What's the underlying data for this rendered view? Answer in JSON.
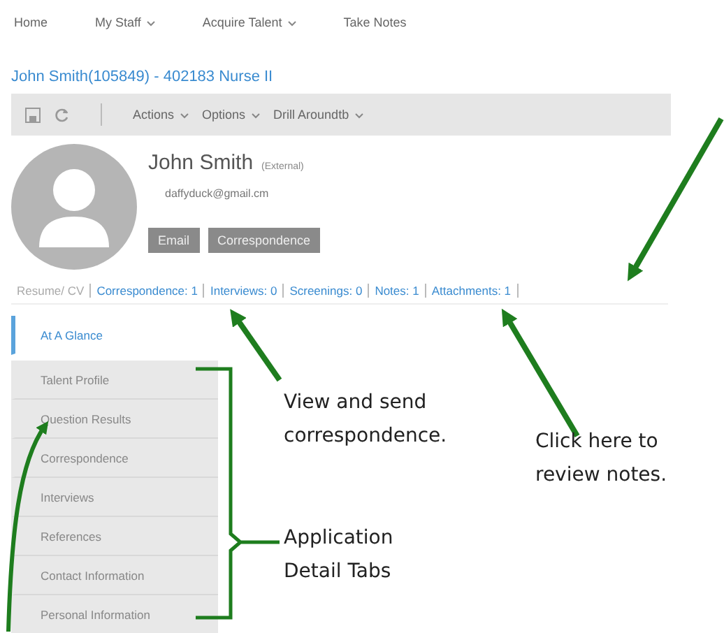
{
  "nav": [
    {
      "label": "Home",
      "dropdown": false
    },
    {
      "label": "My Staff",
      "dropdown": true
    },
    {
      "label": "Acquire Talent",
      "dropdown": true
    },
    {
      "label": "Take Notes",
      "dropdown": false
    }
  ],
  "page_title": "John Smith(105849) - 402183 Nurse II",
  "toolbar": {
    "menus": [
      "Actions",
      "Options",
      "Drill Aroundtb"
    ]
  },
  "profile": {
    "name": "John Smith",
    "badge": "(External)",
    "email": "daffyduck@gmail.cm",
    "buttons": [
      "Email",
      "Correspondence"
    ]
  },
  "links": [
    {
      "label": "Resume/ CV",
      "active": false
    },
    {
      "label": "Correspondence: 1",
      "active": true
    },
    {
      "label": "Interviews: 0",
      "active": true
    },
    {
      "label": "Screenings: 0",
      "active": true
    },
    {
      "label": "Notes: 1",
      "active": true
    },
    {
      "label": "Attachments: 1",
      "active": true
    }
  ],
  "side_tabs": [
    {
      "label": "At A Glance",
      "selected": true
    },
    {
      "label": "Talent Profile",
      "selected": false
    },
    {
      "label": "Question Results",
      "selected": false
    },
    {
      "label": "Correspondence",
      "selected": false
    },
    {
      "label": "Interviews",
      "selected": false
    },
    {
      "label": "References",
      "selected": false
    },
    {
      "label": "Contact Information",
      "selected": false
    },
    {
      "label": "Personal Information",
      "selected": false
    }
  ],
  "annotations": [
    {
      "kind": "note",
      "lines": [
        "View and send",
        "correspondence."
      ]
    },
    {
      "kind": "note",
      "lines": [
        "Click here to",
        "review notes."
      ]
    },
    {
      "kind": "note",
      "lines": [
        "Application",
        "Detail Tabs"
      ]
    }
  ]
}
